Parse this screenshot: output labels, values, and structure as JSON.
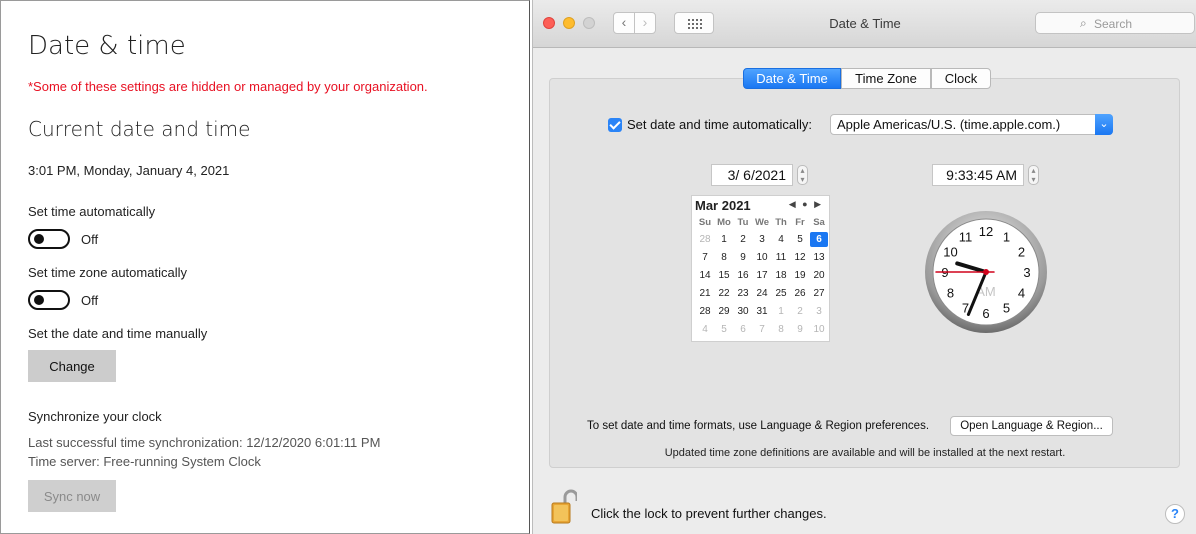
{
  "windows": {
    "title": "Date & time",
    "warning": "*Some of these settings are hidden or managed by your organization.",
    "section_current": "Current date and time",
    "current_datetime": "3:01 PM, Monday, January 4, 2021",
    "set_time_auto_label": "Set time automatically",
    "set_time_auto_state": "Off",
    "set_tz_auto_label": "Set time zone automatically",
    "set_tz_auto_state": "Off",
    "manual_label": "Set the date and time manually",
    "change_button": "Change",
    "sync_heading": "Synchronize your clock",
    "last_sync": "Last successful time synchronization: 12/12/2020 6:01:11 PM",
    "time_server": "Time server: Free-running System Clock",
    "sync_button": "Sync now"
  },
  "mac": {
    "window_title": "Date & Time",
    "search_placeholder": "Search",
    "tabs": [
      "Date & Time",
      "Time Zone",
      "Clock"
    ],
    "active_tab": "Date & Time",
    "auto_checkbox_label": "Set date and time automatically:",
    "auto_checked": true,
    "time_server_value": "Apple Americas/U.S. (time.apple.com.)",
    "date_value": "3/  6/2021",
    "time_value": "9:33:45 AM",
    "calendar": {
      "month_label": "Mar 2021",
      "nav": "◀ ● ▶",
      "weekdays": [
        "Su",
        "Mo",
        "Tu",
        "We",
        "Th",
        "Fr",
        "Sa"
      ],
      "weeks": [
        [
          "28",
          "1",
          "2",
          "3",
          "4",
          "5",
          "6"
        ],
        [
          "7",
          "8",
          "9",
          "10",
          "11",
          "12",
          "13"
        ],
        [
          "14",
          "15",
          "16",
          "17",
          "18",
          "19",
          "20"
        ],
        [
          "21",
          "22",
          "23",
          "24",
          "25",
          "26",
          "27"
        ],
        [
          "28",
          "29",
          "30",
          "31",
          "1",
          "2",
          "3"
        ],
        [
          "4",
          "5",
          "6",
          "7",
          "8",
          "9",
          "10"
        ]
      ],
      "selected_day": "6"
    },
    "clock": {
      "numbers": [
        "12",
        "1",
        "2",
        "3",
        "4",
        "5",
        "6",
        "7",
        "8",
        "9",
        "10",
        "11"
      ],
      "meridiem": "AM",
      "hour": 9,
      "minute": 33,
      "second": 45
    },
    "formats_text": "To set date and time formats, use Language & Region preferences.",
    "open_region_button": "Open Language & Region...",
    "update_text": "Updated time zone definitions are available and will be installed at the next restart.",
    "lock_text": "Click the lock to prevent further changes.",
    "help_label": "?"
  }
}
